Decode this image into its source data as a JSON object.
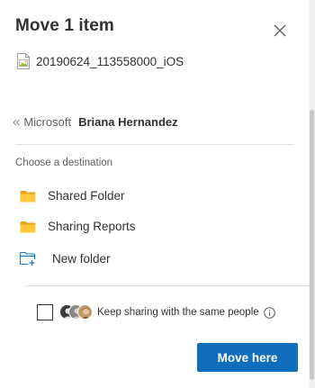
{
  "dialog": {
    "title": "Move 1 item",
    "file_name": "20190624_113558000_iOS"
  },
  "breadcrumb": {
    "parent": "Microsoft",
    "current": "Briana Hernandez"
  },
  "destination": {
    "label": "Choose a destination",
    "items": [
      {
        "label": "Shared Folder",
        "icon": "folder-icon"
      },
      {
        "label": "Sharing Reports",
        "icon": "folder-icon"
      }
    ],
    "new_folder_label": "New folder"
  },
  "sharing": {
    "label": "Keep sharing with the same people",
    "checked": false
  },
  "actions": {
    "move_label": "Move here"
  },
  "colors": {
    "accent": "#106ebe",
    "folder": "#ffb900",
    "new_folder_icon": "#0078d4"
  }
}
